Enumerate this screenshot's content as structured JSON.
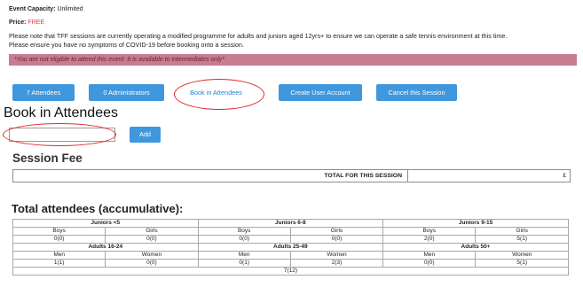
{
  "event": {
    "capacity_label": "Event Capacity:",
    "capacity_value": "Unlimited",
    "price_label": "Price:",
    "price_value": "FREE",
    "notice1": "Please note that TFF sessions are currently operating a modified programme for adults and juniors aged 12yrs+ to ensure we can operate a safe tennis environment at this time.",
    "notice2": "Please ensure you have no symptoms of COVID-19 before booking onto a session.",
    "alert": "*You are not eligible to attend this event: It is available to intermediates only*"
  },
  "buttons": {
    "attendees": "7 Attendees",
    "administrators": "0 Administrators",
    "book_in": "Book in Attendees",
    "create_account": "Create User Account",
    "cancel_session": "Cancel this Session"
  },
  "book": {
    "title": "Book in Attendees",
    "input_value": "",
    "add_label": "Add"
  },
  "fee": {
    "title": "Session Fee",
    "total_label": "TOTAL FOR THIS SESSION",
    "currency": "£"
  },
  "attendees": {
    "title": "Total attendees (accumulative):",
    "groups_row1": [
      "Juniors <5",
      "Juniors 6-8",
      "Juniors 9-15"
    ],
    "sub_row1": [
      "Boys",
      "Girls",
      "Boys",
      "Girls",
      "Boys",
      "Girls"
    ],
    "val_row1": [
      "0(0)",
      "0(0)",
      "0(0)",
      "0(0)",
      "2(0)",
      "5(1)"
    ],
    "groups_row2": [
      "Adults 16-24",
      "Adults 25-49",
      "Adults 50+"
    ],
    "sub_row2": [
      "Men",
      "Women",
      "Men",
      "Women",
      "Men",
      "Women"
    ],
    "val_row2": [
      "1(1)",
      "0(0)",
      "0(1)",
      "2(3)",
      "0(0)",
      "5(1)"
    ],
    "total": "7(12)"
  }
}
